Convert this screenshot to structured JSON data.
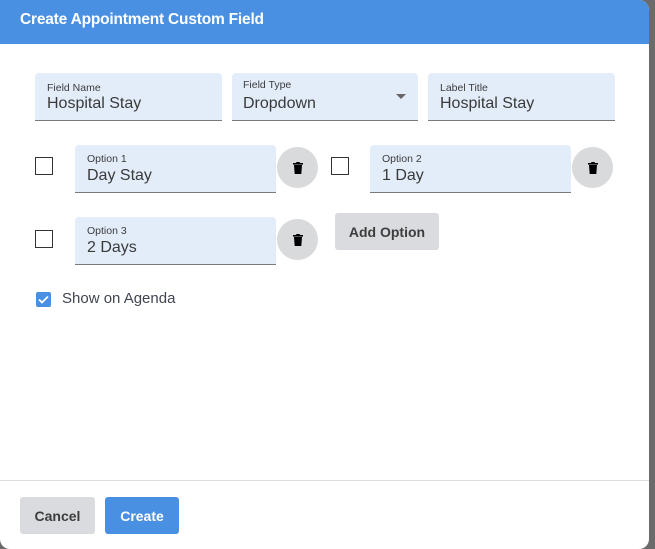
{
  "dialog": {
    "title": "Create Appointment Custom Field"
  },
  "fields": {
    "field_name": {
      "label": "Field Name",
      "value": "Hospital Stay"
    },
    "field_type": {
      "label": "Field Type",
      "value": "Dropdown"
    },
    "label_title": {
      "label": "Label Title",
      "value": "Hospital Stay"
    }
  },
  "options": [
    {
      "label": "Option 1",
      "value": "Day Stay",
      "checked": false
    },
    {
      "label": "Option 2",
      "value": "1 Day",
      "checked": false
    },
    {
      "label": "Option 3",
      "value": "2 Days",
      "checked": false
    }
  ],
  "add_option_label": "Add Option",
  "show_on_agenda": {
    "label": "Show on Agenda",
    "checked": true
  },
  "footer": {
    "cancel_label": "Cancel",
    "create_label": "Create"
  },
  "colors": {
    "accent": "#4a90e2",
    "field_bg": "#e3edf9",
    "button_gray": "#dadbde"
  },
  "icons": {
    "delete": "trash-icon",
    "dropdown": "caret-down-icon",
    "check": "check-icon"
  }
}
